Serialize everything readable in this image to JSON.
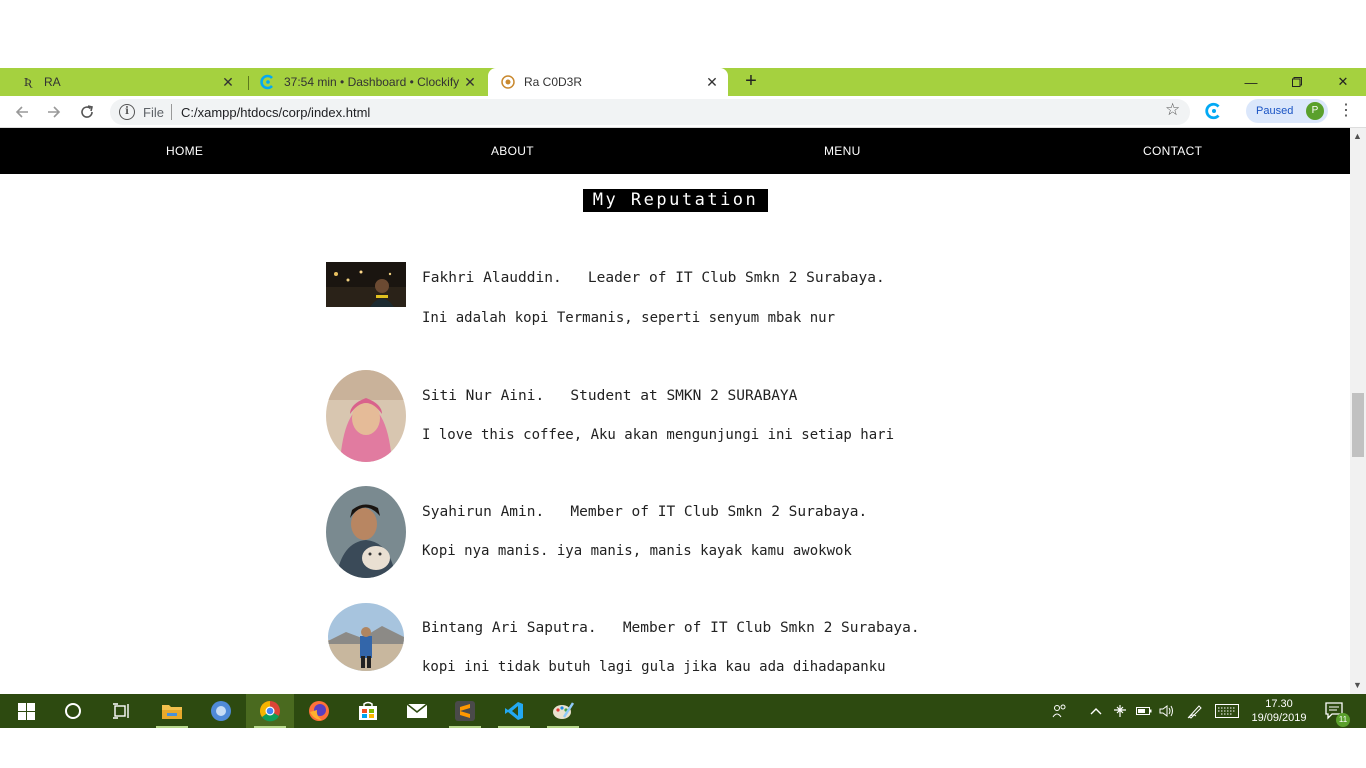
{
  "browser": {
    "tabs": [
      {
        "title": "RA",
        "icon": "ra-logo-icon"
      },
      {
        "title": "37:54 min • Dashboard • Clockify",
        "icon": "clockify-icon"
      },
      {
        "title": "Ra C0D3R",
        "icon": "site-icon"
      }
    ],
    "address": {
      "scheme": "File",
      "url": "C:/xampp/htdocs/corp/index.html"
    },
    "profile": {
      "label": "Paused",
      "initial": "P"
    }
  },
  "site": {
    "nav": [
      "HOME",
      "ABOUT",
      "MENU",
      "CONTACT"
    ],
    "heading": "My Reputation",
    "reviews": [
      {
        "name": "Fakhri Alauddin.",
        "role": "Leader of IT Club Smkn 2 Surabaya.",
        "text": "Ini adalah kopi Termanis, seperti senyum mbak nur"
      },
      {
        "name": "Siti Nur Aini.",
        "role": "Student at SMKN 2 SURABAYA",
        "text": "I love this coffee, Aku akan mengunjungi ini setiap hari"
      },
      {
        "name": "Syahirun Amin.",
        "role": "Member of IT Club Smkn 2 Surabaya.",
        "text": "Kopi nya manis. iya manis, manis kayak kamu awokwok"
      },
      {
        "name": "Bintang Ari Saputra.",
        "role": "Member of IT Club Smkn 2 Surabaya.",
        "text": "kopi ini tidak butuh lagi gula jika kau ada dihadapanku"
      }
    ]
  },
  "taskbar": {
    "time": "17.30",
    "date": "19/09/2019",
    "notifications": "11"
  },
  "colors": {
    "tabstrip": "#a5d13f",
    "taskbar": "#2d4a10",
    "nav": "#000000"
  }
}
